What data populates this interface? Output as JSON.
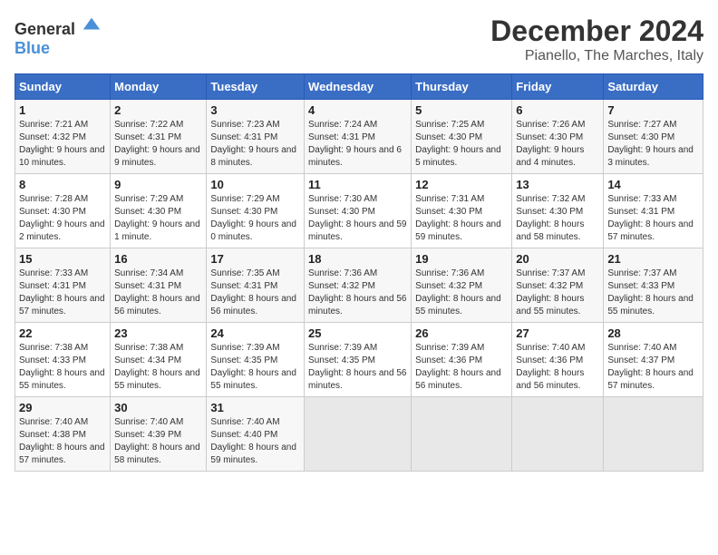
{
  "logo": {
    "general": "General",
    "blue": "Blue"
  },
  "title": "December 2024",
  "subtitle": "Pianello, The Marches, Italy",
  "headers": [
    "Sunday",
    "Monday",
    "Tuesday",
    "Wednesday",
    "Thursday",
    "Friday",
    "Saturday"
  ],
  "weeks": [
    [
      {
        "day": "1",
        "rise": "Sunrise: 7:21 AM",
        "set": "Sunset: 4:32 PM",
        "daylight": "Daylight: 9 hours and 10 minutes."
      },
      {
        "day": "2",
        "rise": "Sunrise: 7:22 AM",
        "set": "Sunset: 4:31 PM",
        "daylight": "Daylight: 9 hours and 9 minutes."
      },
      {
        "day": "3",
        "rise": "Sunrise: 7:23 AM",
        "set": "Sunset: 4:31 PM",
        "daylight": "Daylight: 9 hours and 8 minutes."
      },
      {
        "day": "4",
        "rise": "Sunrise: 7:24 AM",
        "set": "Sunset: 4:31 PM",
        "daylight": "Daylight: 9 hours and 6 minutes."
      },
      {
        "day": "5",
        "rise": "Sunrise: 7:25 AM",
        "set": "Sunset: 4:30 PM",
        "daylight": "Daylight: 9 hours and 5 minutes."
      },
      {
        "day": "6",
        "rise": "Sunrise: 7:26 AM",
        "set": "Sunset: 4:30 PM",
        "daylight": "Daylight: 9 hours and 4 minutes."
      },
      {
        "day": "7",
        "rise": "Sunrise: 7:27 AM",
        "set": "Sunset: 4:30 PM",
        "daylight": "Daylight: 9 hours and 3 minutes."
      }
    ],
    [
      {
        "day": "8",
        "rise": "Sunrise: 7:28 AM",
        "set": "Sunset: 4:30 PM",
        "daylight": "Daylight: 9 hours and 2 minutes."
      },
      {
        "day": "9",
        "rise": "Sunrise: 7:29 AM",
        "set": "Sunset: 4:30 PM",
        "daylight": "Daylight: 9 hours and 1 minute."
      },
      {
        "day": "10",
        "rise": "Sunrise: 7:29 AM",
        "set": "Sunset: 4:30 PM",
        "daylight": "Daylight: 9 hours and 0 minutes."
      },
      {
        "day": "11",
        "rise": "Sunrise: 7:30 AM",
        "set": "Sunset: 4:30 PM",
        "daylight": "Daylight: 8 hours and 59 minutes."
      },
      {
        "day": "12",
        "rise": "Sunrise: 7:31 AM",
        "set": "Sunset: 4:30 PM",
        "daylight": "Daylight: 8 hours and 59 minutes."
      },
      {
        "day": "13",
        "rise": "Sunrise: 7:32 AM",
        "set": "Sunset: 4:30 PM",
        "daylight": "Daylight: 8 hours and 58 minutes."
      },
      {
        "day": "14",
        "rise": "Sunrise: 7:33 AM",
        "set": "Sunset: 4:31 PM",
        "daylight": "Daylight: 8 hours and 57 minutes."
      }
    ],
    [
      {
        "day": "15",
        "rise": "Sunrise: 7:33 AM",
        "set": "Sunset: 4:31 PM",
        "daylight": "Daylight: 8 hours and 57 minutes."
      },
      {
        "day": "16",
        "rise": "Sunrise: 7:34 AM",
        "set": "Sunset: 4:31 PM",
        "daylight": "Daylight: 8 hours and 56 minutes."
      },
      {
        "day": "17",
        "rise": "Sunrise: 7:35 AM",
        "set": "Sunset: 4:31 PM",
        "daylight": "Daylight: 8 hours and 56 minutes."
      },
      {
        "day": "18",
        "rise": "Sunrise: 7:36 AM",
        "set": "Sunset: 4:32 PM",
        "daylight": "Daylight: 8 hours and 56 minutes."
      },
      {
        "day": "19",
        "rise": "Sunrise: 7:36 AM",
        "set": "Sunset: 4:32 PM",
        "daylight": "Daylight: 8 hours and 55 minutes."
      },
      {
        "day": "20",
        "rise": "Sunrise: 7:37 AM",
        "set": "Sunset: 4:32 PM",
        "daylight": "Daylight: 8 hours and 55 minutes."
      },
      {
        "day": "21",
        "rise": "Sunrise: 7:37 AM",
        "set": "Sunset: 4:33 PM",
        "daylight": "Daylight: 8 hours and 55 minutes."
      }
    ],
    [
      {
        "day": "22",
        "rise": "Sunrise: 7:38 AM",
        "set": "Sunset: 4:33 PM",
        "daylight": "Daylight: 8 hours and 55 minutes."
      },
      {
        "day": "23",
        "rise": "Sunrise: 7:38 AM",
        "set": "Sunset: 4:34 PM",
        "daylight": "Daylight: 8 hours and 55 minutes."
      },
      {
        "day": "24",
        "rise": "Sunrise: 7:39 AM",
        "set": "Sunset: 4:35 PM",
        "daylight": "Daylight: 8 hours and 55 minutes."
      },
      {
        "day": "25",
        "rise": "Sunrise: 7:39 AM",
        "set": "Sunset: 4:35 PM",
        "daylight": "Daylight: 8 hours and 56 minutes."
      },
      {
        "day": "26",
        "rise": "Sunrise: 7:39 AM",
        "set": "Sunset: 4:36 PM",
        "daylight": "Daylight: 8 hours and 56 minutes."
      },
      {
        "day": "27",
        "rise": "Sunrise: 7:40 AM",
        "set": "Sunset: 4:36 PM",
        "daylight": "Daylight: 8 hours and 56 minutes."
      },
      {
        "day": "28",
        "rise": "Sunrise: 7:40 AM",
        "set": "Sunset: 4:37 PM",
        "daylight": "Daylight: 8 hours and 57 minutes."
      }
    ],
    [
      {
        "day": "29",
        "rise": "Sunrise: 7:40 AM",
        "set": "Sunset: 4:38 PM",
        "daylight": "Daylight: 8 hours and 57 minutes."
      },
      {
        "day": "30",
        "rise": "Sunrise: 7:40 AM",
        "set": "Sunset: 4:39 PM",
        "daylight": "Daylight: 8 hours and 58 minutes."
      },
      {
        "day": "31",
        "rise": "Sunrise: 7:40 AM",
        "set": "Sunset: 4:40 PM",
        "daylight": "Daylight: 8 hours and 59 minutes."
      },
      null,
      null,
      null,
      null
    ]
  ]
}
